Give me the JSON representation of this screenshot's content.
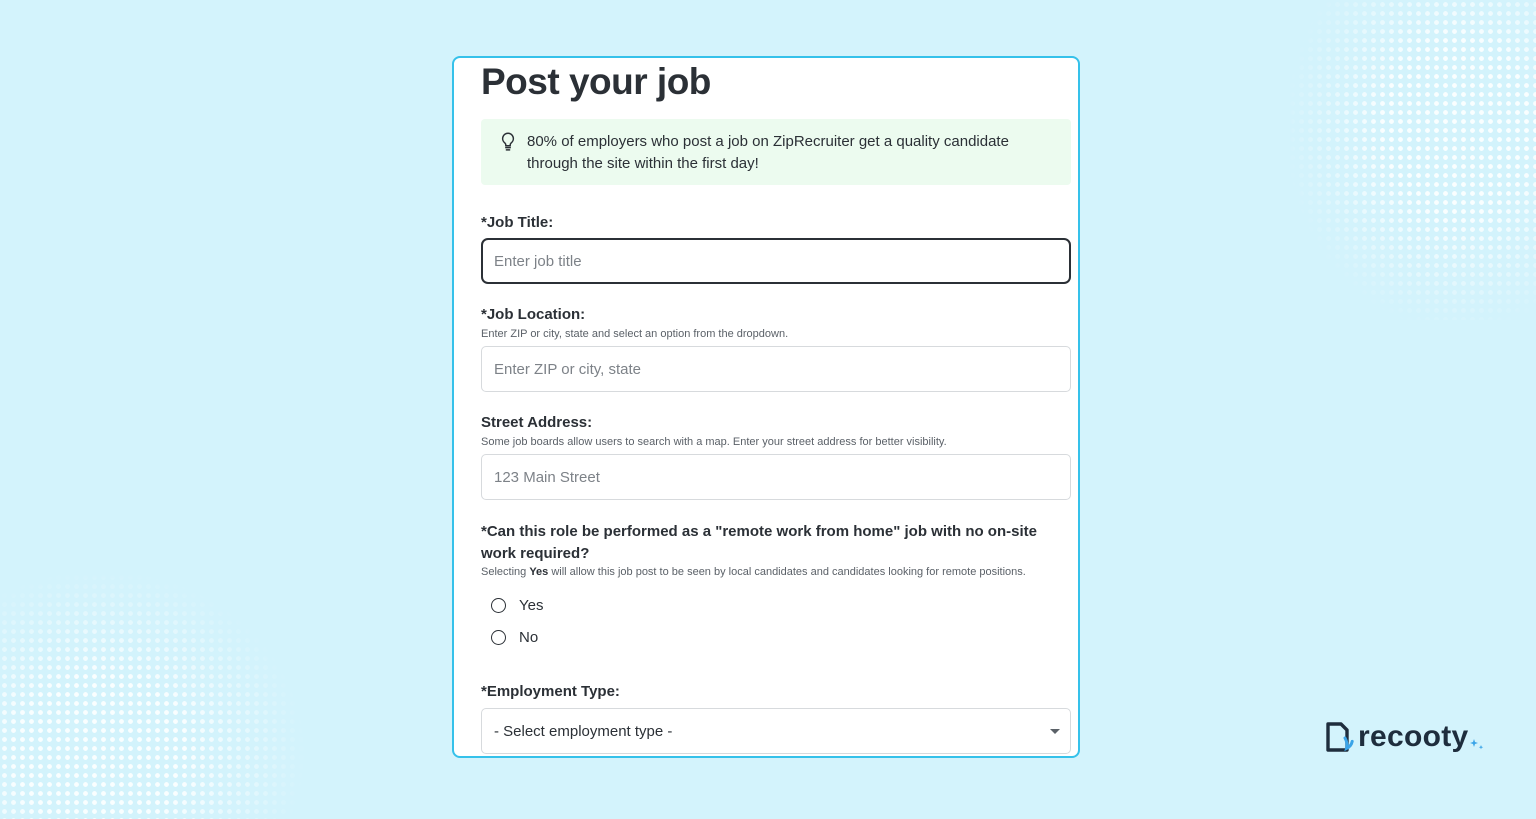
{
  "page": {
    "background_color": "#d3f3fc",
    "accent_color": "#35c1ea"
  },
  "form": {
    "title": "Post your job",
    "tip": {
      "icon": "lightbulb-icon",
      "text": "80% of employers who post a job on ZipRecruiter get a quality candidate through the site within the first day!",
      "background_color": "#ecfbef"
    },
    "job_title": {
      "label": "*Job Title:",
      "placeholder": "Enter job title",
      "value": ""
    },
    "job_location": {
      "label": "*Job Location:",
      "help": "Enter ZIP or city, state and select an option from the dropdown.",
      "placeholder": "Enter ZIP or city, state",
      "value": ""
    },
    "street_address": {
      "label": "Street Address:",
      "help": "Some job boards allow users to search with a map. Enter your street address for better visibility.",
      "placeholder": "123 Main Street",
      "value": ""
    },
    "remote": {
      "label": "*Can this role be performed as a \"remote work from home\" job with no on-site work required?",
      "help_prefix": "Selecting ",
      "help_bold": "Yes",
      "help_suffix": " will allow this job post to be seen by local candidates and candidates looking for remote positions.",
      "options": [
        "Yes",
        "No"
      ],
      "selected": null
    },
    "employment_type": {
      "label": "*Employment Type:",
      "selected": "- Select employment type -"
    }
  },
  "brand": {
    "name": "recooty",
    "logo_icon": "recooty-logo-icon",
    "spark_icon": "sparkle-icon"
  }
}
